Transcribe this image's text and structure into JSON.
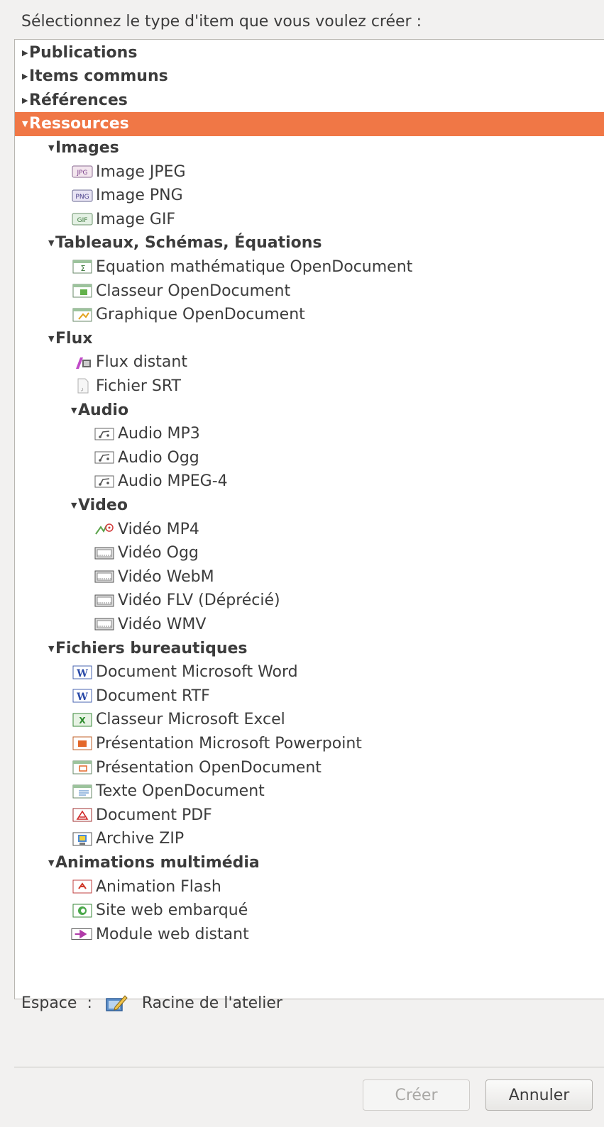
{
  "dialog": {
    "prompt": "Sélectionnez le type d'item que vous voulez créer :",
    "workspace_label": "Espace",
    "workspace_colon": ":",
    "workspace_value": "Racine de l'atelier",
    "create_button": "Créer",
    "cancel_button": "Annuler"
  },
  "tree": [
    {
      "label": "Publications",
      "depth": 0,
      "bold": true,
      "arrow": "collapsed"
    },
    {
      "label": "Items communs",
      "depth": 0,
      "bold": true,
      "arrow": "collapsed"
    },
    {
      "label": "Références",
      "depth": 0,
      "bold": true,
      "arrow": "collapsed"
    },
    {
      "label": "Ressources",
      "depth": 0,
      "bold": true,
      "arrow": "expanded",
      "selected": true
    },
    {
      "label": "Images",
      "depth": 1,
      "bold": true,
      "arrow": "expanded"
    },
    {
      "label": "Image JPEG",
      "depth": 2,
      "icon": "jpg-icon"
    },
    {
      "label": "Image PNG",
      "depth": 2,
      "icon": "png-icon"
    },
    {
      "label": "Image GIF",
      "depth": 2,
      "icon": "gif-icon"
    },
    {
      "label": "Tableaux, Schémas, Équations",
      "depth": 1,
      "bold": true,
      "arrow": "expanded"
    },
    {
      "label": "Equation mathématique OpenDocument",
      "depth": 2,
      "icon": "odf-formula-icon"
    },
    {
      "label": "Classeur OpenDocument",
      "depth": 2,
      "icon": "ods-icon"
    },
    {
      "label": "Graphique OpenDocument",
      "depth": 2,
      "icon": "odg-icon"
    },
    {
      "label": "Flux",
      "depth": 1,
      "bold": true,
      "arrow": "expanded"
    },
    {
      "label": "Flux distant",
      "depth": 2,
      "icon": "remote-stream-icon"
    },
    {
      "label": "Fichier SRT",
      "depth": 2,
      "icon": "srt-file-icon"
    },
    {
      "label": "Audio",
      "depth": 2,
      "bold": true,
      "arrow": "expanded"
    },
    {
      "label": "Audio MP3",
      "depth": 3,
      "icon": "audio-icon"
    },
    {
      "label": "Audio Ogg",
      "depth": 3,
      "icon": "audio-icon"
    },
    {
      "label": "Audio MPEG-4",
      "depth": 3,
      "icon": "audio-icon"
    },
    {
      "label": "Video",
      "depth": 2,
      "bold": true,
      "arrow": "expanded"
    },
    {
      "label": "Vidéo MP4",
      "depth": 3,
      "icon": "mp4-video-icon"
    },
    {
      "label": "Vidéo Ogg",
      "depth": 3,
      "icon": "video-icon"
    },
    {
      "label": "Vidéo WebM",
      "depth": 3,
      "icon": "video-icon"
    },
    {
      "label": "Vidéo FLV (Déprécié)",
      "depth": 3,
      "icon": "video-icon"
    },
    {
      "label": "Vidéo WMV",
      "depth": 3,
      "icon": "video-icon"
    },
    {
      "label": "Fichiers bureautiques",
      "depth": 1,
      "bold": true,
      "arrow": "expanded"
    },
    {
      "label": "Document Microsoft Word",
      "depth": 2,
      "icon": "word-icon"
    },
    {
      "label": "Document RTF",
      "depth": 2,
      "icon": "word-icon"
    },
    {
      "label": "Classeur Microsoft Excel",
      "depth": 2,
      "icon": "excel-icon"
    },
    {
      "label": "Présentation Microsoft Powerpoint",
      "depth": 2,
      "icon": "powerpoint-icon"
    },
    {
      "label": "Présentation OpenDocument",
      "depth": 2,
      "icon": "odp-icon"
    },
    {
      "label": "Texte OpenDocument",
      "depth": 2,
      "icon": "odt-icon"
    },
    {
      "label": "Document PDF",
      "depth": 2,
      "icon": "pdf-icon"
    },
    {
      "label": "Archive ZIP",
      "depth": 2,
      "icon": "zip-icon"
    },
    {
      "label": "Animations multimédia",
      "depth": 1,
      "bold": true,
      "arrow": "expanded"
    },
    {
      "label": "Animation Flash",
      "depth": 2,
      "icon": "flash-icon"
    },
    {
      "label": "Site web embarqué",
      "depth": 2,
      "icon": "website-icon"
    },
    {
      "label": "Module web distant",
      "depth": 2,
      "icon": "web-module-icon"
    }
  ],
  "colors": {
    "selection": "#f07746",
    "background": "#f2f1f0",
    "tree_background": "#ffffff"
  }
}
